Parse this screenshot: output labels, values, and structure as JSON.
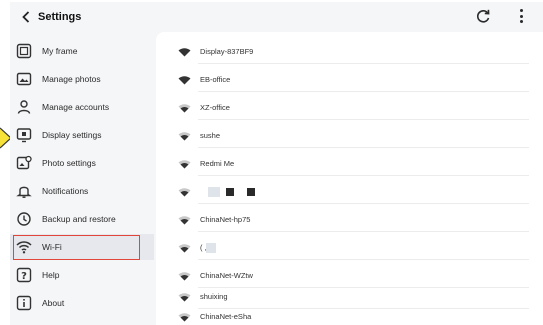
{
  "header": {
    "title": "Settings",
    "back_icon": "chevron-left-icon",
    "refresh_icon": "refresh-icon",
    "more_icon": "more-vertical-icon"
  },
  "sidebar": {
    "selected_index": 8,
    "items": [
      {
        "label": "My frame",
        "icon": "frame-icon"
      },
      {
        "label": "Manage photos",
        "icon": "photos-icon"
      },
      {
        "label": "Manage accounts",
        "icon": "accounts-icon"
      },
      {
        "label": "Display settings",
        "icon": "display-icon"
      },
      {
        "label": "Photo settings",
        "icon": "photo-settings-icon"
      },
      {
        "label": "Notifications",
        "icon": "bell-icon"
      },
      {
        "label": "Backup and restore",
        "icon": "backup-icon"
      },
      {
        "label": "Wi-Fi",
        "icon": "wifi-icon"
      },
      {
        "label": "Help",
        "icon": "help-icon"
      },
      {
        "label": "About",
        "icon": "info-icon"
      }
    ]
  },
  "networks": [
    {
      "ssid": "Display-837BF9",
      "signal": "full"
    },
    {
      "ssid": "EB-office",
      "signal": "full"
    },
    {
      "ssid": "XZ-office",
      "signal": "medium"
    },
    {
      "ssid": "sushe",
      "signal": "medium"
    },
    {
      "ssid": "Redmi Me",
      "signal": "medium"
    },
    {
      "ssid": "",
      "signal": "medium"
    },
    {
      "ssid": "ChinaNet-hp75",
      "signal": "medium"
    },
    {
      "ssid": "( ,",
      "signal": "medium"
    },
    {
      "ssid": "ChinaNet-WZtw",
      "signal": "medium"
    },
    {
      "ssid": "shuixing",
      "signal": "medium"
    },
    {
      "ssid": "ChinaNet-eSha",
      "signal": "medium"
    }
  ],
  "colors": {
    "highlight_border": "#e0473a",
    "selected_bg": "#e6e8ee",
    "pointer_fill": "#f7e23a"
  }
}
